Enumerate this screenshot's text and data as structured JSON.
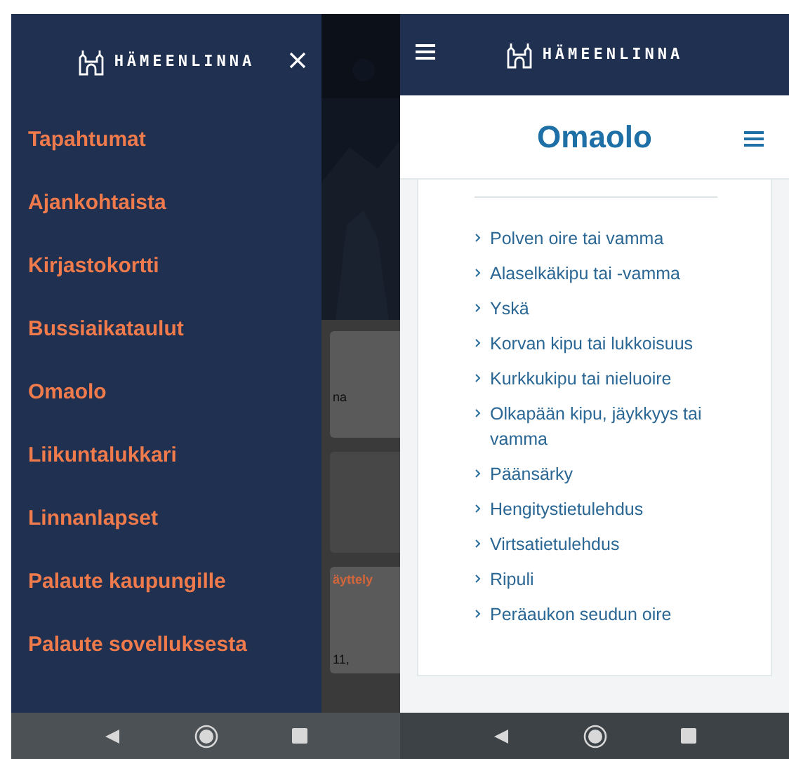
{
  "left_screen": {
    "drawer": {
      "logo_text": "HÄMEENLINNA",
      "items": [
        {
          "label": "Tapahtumat"
        },
        {
          "label": "Ajankohtaista"
        },
        {
          "label": "Kirjastokortti"
        },
        {
          "label": "Bussiaikataulut"
        },
        {
          "label": "Omaolo"
        },
        {
          "label": "Liikuntalukkari"
        },
        {
          "label": "Linnanlapset"
        },
        {
          "label": "Palaute kaupungille"
        },
        {
          "label": "Palaute sovelluksesta"
        }
      ]
    },
    "background_cards": [
      {
        "kind": "text",
        "texts": [
          {
            "kind": "body",
            "text": "na"
          }
        ]
      },
      {
        "kind": "blank"
      },
      {
        "kind": "text",
        "texts": [
          {
            "kind": "heading",
            "text": "äyttely"
          },
          {
            "kind": "body",
            "text": "11,"
          }
        ]
      }
    ]
  },
  "right_screen": {
    "header": {
      "logo_text": "HÄMEENLINNA"
    },
    "page_title": "Omaolo",
    "symptom_links": [
      {
        "label": "Polven oire tai vamma"
      },
      {
        "label": "Alaselkäkipu tai -vamma"
      },
      {
        "label": "Yskä"
      },
      {
        "label": "Korvan kipu tai lukkoisuus"
      },
      {
        "label": "Kurkkukipu tai nieluoire"
      },
      {
        "label": "Olkapään kipu, jäykkyys tai vamma"
      },
      {
        "label": "Päänsärky"
      },
      {
        "label": "Hengitystietulehdus"
      },
      {
        "label": "Virtsatietulehdus"
      },
      {
        "label": "Ripuli"
      },
      {
        "label": "Peräaukon seudun oire"
      }
    ]
  }
}
